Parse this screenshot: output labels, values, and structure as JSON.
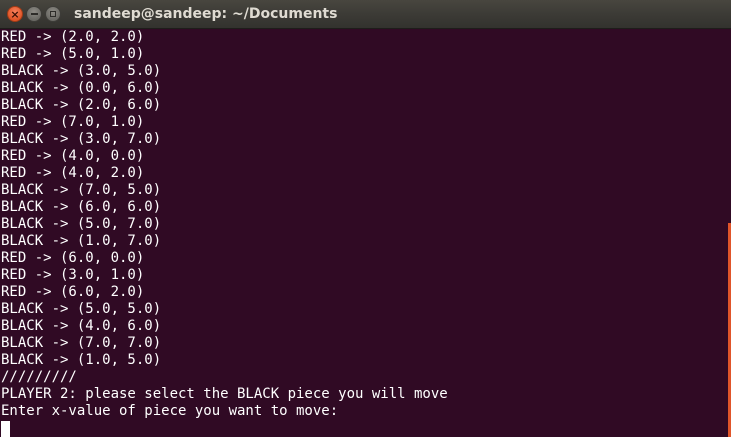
{
  "window": {
    "title": "sandeep@sandeep: ~/Documents",
    "close_label": "×",
    "accent_color": "#e0552a",
    "background_color": "#300a24"
  },
  "terminal": {
    "lines": [
      "RED -> (2.0, 2.0)",
      "RED -> (5.0, 1.0)",
      "BLACK -> (3.0, 5.0)",
      "BLACK -> (0.0, 6.0)",
      "BLACK -> (2.0, 6.0)",
      "RED -> (7.0, 1.0)",
      "BLACK -> (3.0, 7.0)",
      "RED -> (4.0, 0.0)",
      "RED -> (4.0, 2.0)",
      "BLACK -> (7.0, 5.0)",
      "BLACK -> (6.0, 6.0)",
      "BLACK -> (5.0, 7.0)",
      "BLACK -> (1.0, 7.0)",
      "RED -> (6.0, 0.0)",
      "RED -> (3.0, 1.0)",
      "RED -> (6.0, 2.0)",
      "BLACK -> (5.0, 5.0)",
      "BLACK -> (4.0, 6.0)",
      "BLACK -> (7.0, 7.0)",
      "BLACK -> (1.0, 5.0)",
      "/////////",
      "PLAYER 2: please select the BLACK piece you will move",
      "Enter x-value of piece you want to move:"
    ]
  }
}
